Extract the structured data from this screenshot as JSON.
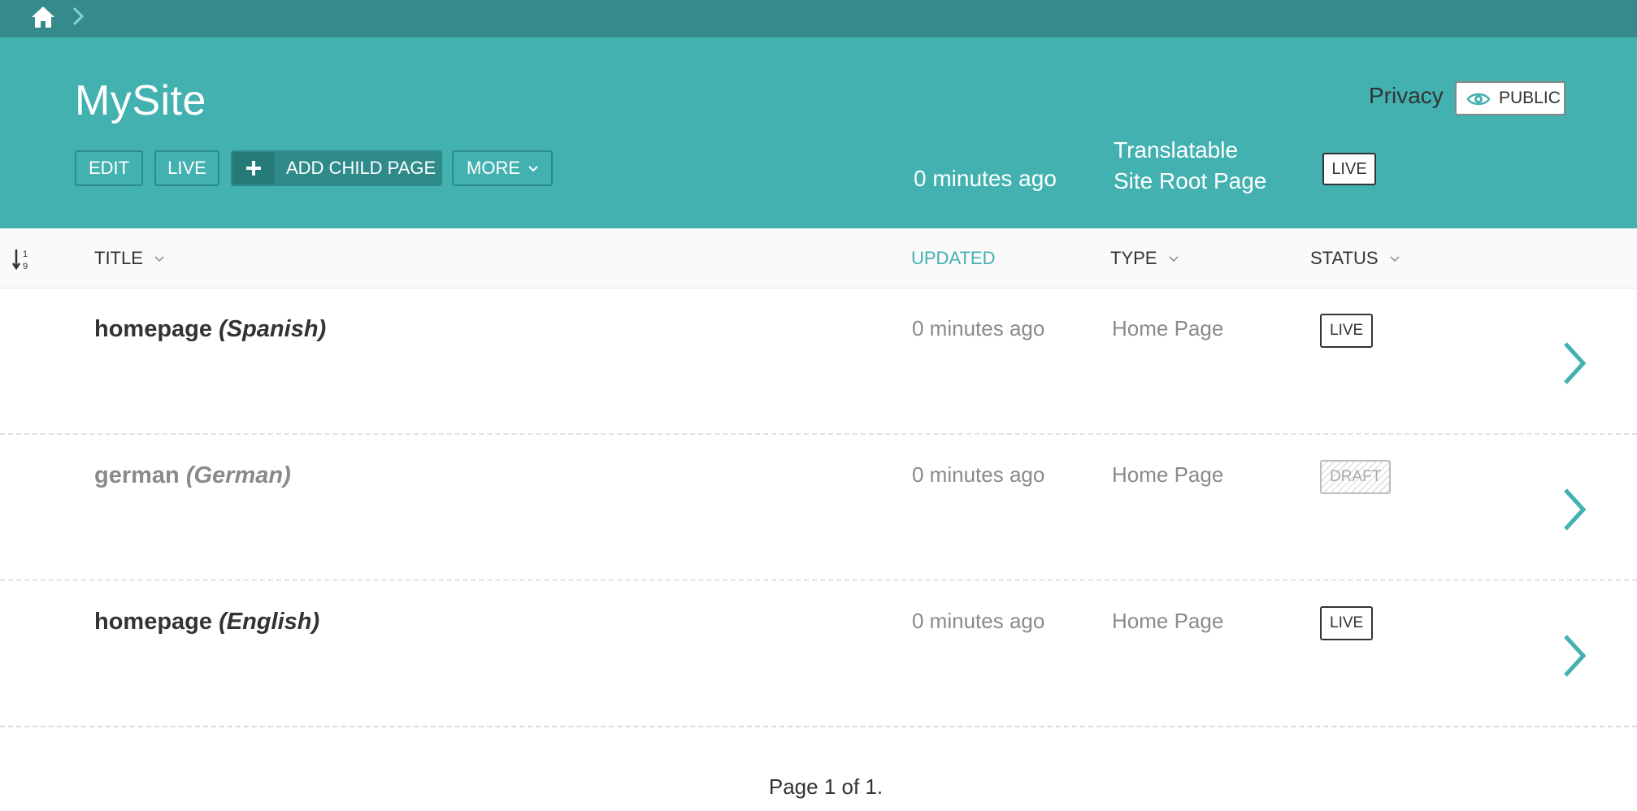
{
  "breadcrumb": {
    "home_icon": "home-icon",
    "separator_icon": "chevron-right-icon"
  },
  "header": {
    "title": "MySite",
    "buttons": {
      "edit": "EDIT",
      "live": "LIVE",
      "add_child": "ADD CHILD PAGE",
      "more": "MORE"
    },
    "updated": "0 minutes ago",
    "type_line1": "Translatable",
    "type_line2": "Site Root Page",
    "status": "LIVE",
    "privacy_label": "Privacy",
    "privacy_value": "PUBLIC"
  },
  "columns": {
    "title": "TITLE",
    "updated": "UPDATED",
    "type": "TYPE",
    "status": "STATUS"
  },
  "rows": [
    {
      "title": "homepage",
      "locale": "(Spanish)",
      "updated": "0 minutes ago",
      "type": "Home Page",
      "status": "LIVE"
    },
    {
      "title": "german",
      "locale": "(German)",
      "updated": "0 minutes ago",
      "type": "Home Page",
      "status": "DRAFT"
    },
    {
      "title": "homepage",
      "locale": "(English)",
      "updated": "0 minutes ago",
      "type": "Home Page",
      "status": "LIVE"
    }
  ],
  "pagination": "Page 1 of 1.",
  "colors": {
    "topbar": "#358b8b",
    "header": "#43b1b0",
    "accent": "#43b1b0",
    "button_dark": "#2e8b89"
  }
}
